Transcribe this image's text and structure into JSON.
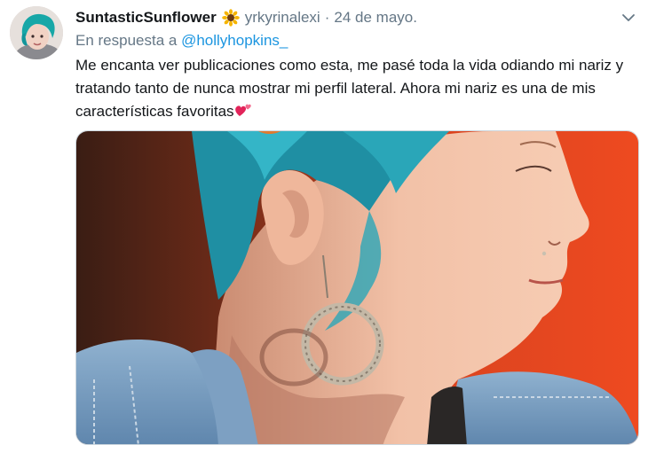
{
  "tweet": {
    "display_name": "SuntasticSunflower",
    "name_emoji": "sunflower-emoji",
    "handle": "yrkyrinalexi",
    "separator": "·",
    "date": "24 de mayo.",
    "reply_prefix": "En respuesta a ",
    "reply_to": "@hollyhopkins_",
    "text": "Me encanta ver publicaciones como esta, me pasé toda la vida odiando mi nariz y tratando tanto de nunca mostrar mi perfil lateral. Ahora mi nariz es una de mis características favoritas",
    "text_emoji": "two-hearts-emoji"
  },
  "colors": {
    "link": "#1b95e0",
    "secondary_text": "#657786",
    "primary_text": "#14171a",
    "photo_background": "#e8401e",
    "hair": "#2aa6b8"
  },
  "icons": {
    "menu": "chevron-down-icon"
  }
}
